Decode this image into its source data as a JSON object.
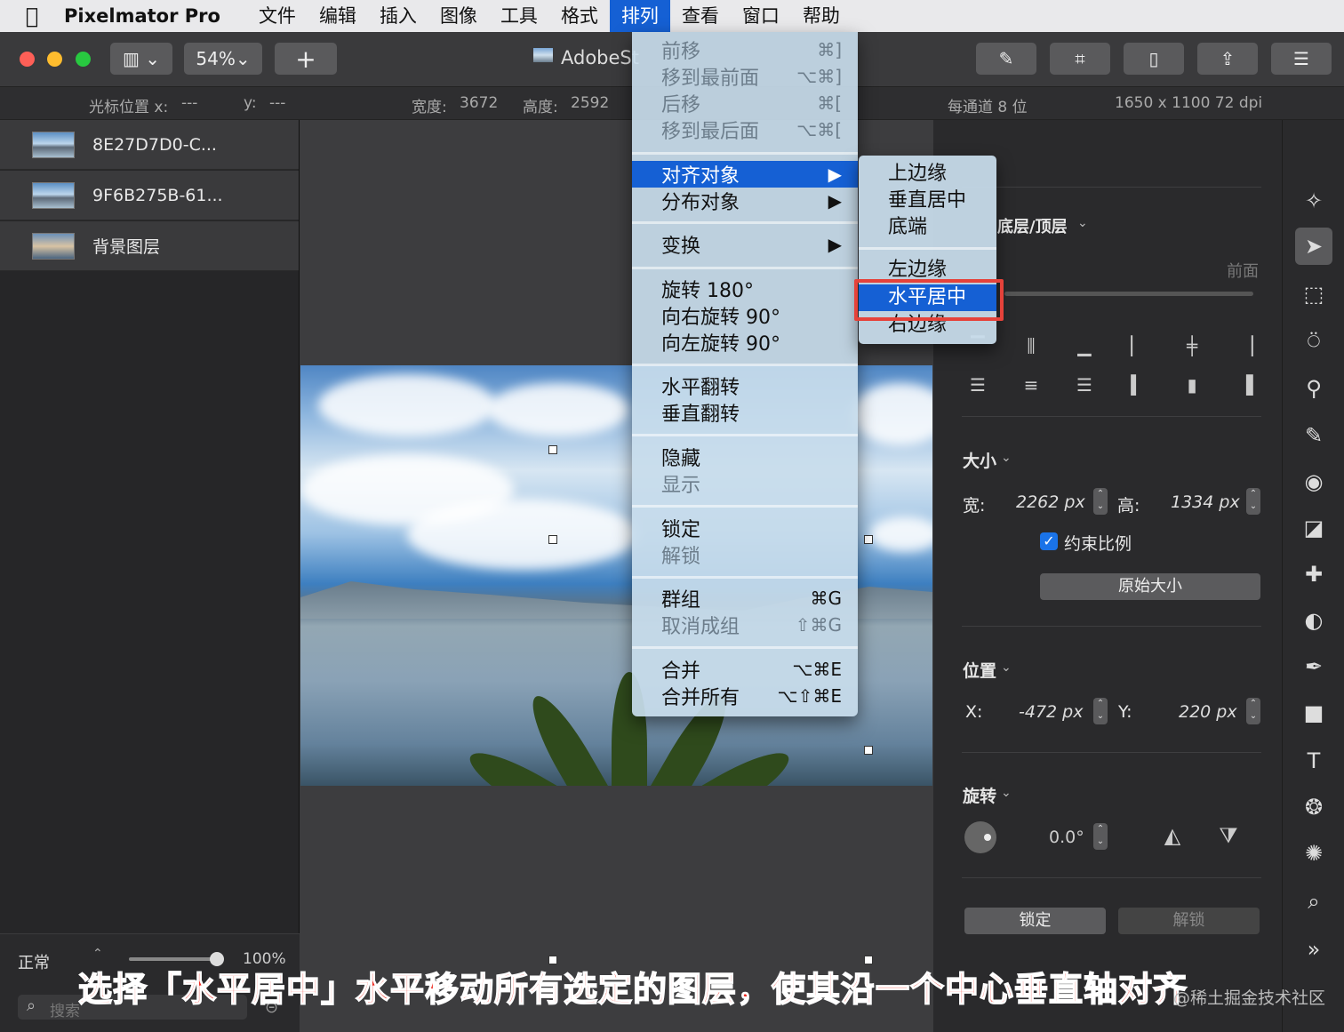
{
  "menubar": {
    "apple": "",
    "app_name": "Pixelmator Pro",
    "items": [
      "文件",
      "编辑",
      "插入",
      "图像",
      "工具",
      "格式",
      "排列",
      "查看",
      "窗口",
      "帮助"
    ]
  },
  "toolbar": {
    "zoom": "54%",
    "add": "+",
    "doc_title": "AdobeSt"
  },
  "infobar": {
    "cursor_x_label": "光标位置 x:",
    "cursor_x_value": "---",
    "cursor_y_label": "y:",
    "cursor_y_value": "---",
    "width_label": "宽度:",
    "width_value": "3672",
    "height_label": "高度:",
    "height_value": "2592",
    "bits": "每通道 8 位",
    "size_dpi": "1650 x 1100 72 dpi"
  },
  "layers": [
    {
      "name": "8E27D7D0-C..."
    },
    {
      "name": "9F6B275B-61..."
    },
    {
      "name": "背景图层"
    }
  ],
  "layers_footer": {
    "blend": "正常",
    "opacity": "100%",
    "search_placeholder": "搜索",
    "opacity_fraction": 1.0
  },
  "arrange_menu": {
    "items": [
      {
        "label": "前移",
        "shortcut": "⌘]",
        "disabled": true
      },
      {
        "label": "移到最前面",
        "shortcut": "⌥⌘]",
        "disabled": true
      },
      {
        "label": "后移",
        "shortcut": "⌘[",
        "disabled": true
      },
      {
        "label": "移到最后面",
        "shortcut": "⌥⌘[",
        "disabled": true
      },
      {
        "label": "对齐对象",
        "shortcut": "▶",
        "highlighted": true
      },
      {
        "label": "分布对象",
        "shortcut": "▶"
      },
      {
        "label": "变换",
        "shortcut": "▶"
      },
      {
        "label": "旋转 180°",
        "shortcut": ""
      },
      {
        "label": "向右旋转 90°",
        "shortcut": ""
      },
      {
        "label": "向左旋转 90°",
        "shortcut": ""
      },
      {
        "label": "水平翻转",
        "shortcut": ""
      },
      {
        "label": "垂直翻转",
        "shortcut": ""
      },
      {
        "label": "隐藏",
        "shortcut": ""
      },
      {
        "label": "显示",
        "shortcut": "",
        "disabled": true
      },
      {
        "label": "锁定",
        "shortcut": ""
      },
      {
        "label": "解锁",
        "shortcut": "",
        "disabled": true
      },
      {
        "label": "群组",
        "shortcut": "⌘G"
      },
      {
        "label": "取消成组",
        "shortcut": "⇧⌘G",
        "disabled": true
      },
      {
        "label": "合并",
        "shortcut": "⌥⌘E"
      },
      {
        "label": "合并所有",
        "shortcut": "⌥⇧⌘E"
      }
    ]
  },
  "align_submenu": {
    "items": [
      "上边缘",
      "垂直居中",
      "底端",
      "左边缘",
      "水平居中",
      "右边缘"
    ],
    "highlighted": "水平居中"
  },
  "inspector": {
    "arrange_title": "底层/顶层",
    "front_label": "前面",
    "size_title": "大小",
    "width_label": "宽:",
    "width_value": "2262 px",
    "height_label": "高:",
    "height_value": "1334 px",
    "constrain_label": "约束比例",
    "constrain_checked": true,
    "original_size": "原始大小",
    "position_title": "位置",
    "x_label": "X:",
    "x_value": "-472 px",
    "y_label": "Y:",
    "y_value": "220 px",
    "rotate_title": "旋转",
    "rotate_value": "0.0°",
    "lock": "锁定",
    "unlock": "解锁"
  },
  "tools": [
    "style-icon",
    "arrange-icon",
    "select-icon",
    "lasso-icon",
    "color-picker-icon",
    "paint-icon",
    "fill-icon",
    "erase-icon",
    "repair-icon",
    "effects-icon",
    "pen-icon",
    "shape-icon",
    "type-icon",
    "color-adjust-icon",
    "sharpen-icon",
    "zoom-icon",
    "more-icon"
  ],
  "caption": "选择「水平居中」水平移动所有选定的图层，使其沿一个中心垂直轴对齐",
  "watermark": "@稀土掘金技术社区",
  "colors": {
    "accent": "#1560d4",
    "highlight_box": "#e5423a",
    "caption": "#ee2a20"
  }
}
